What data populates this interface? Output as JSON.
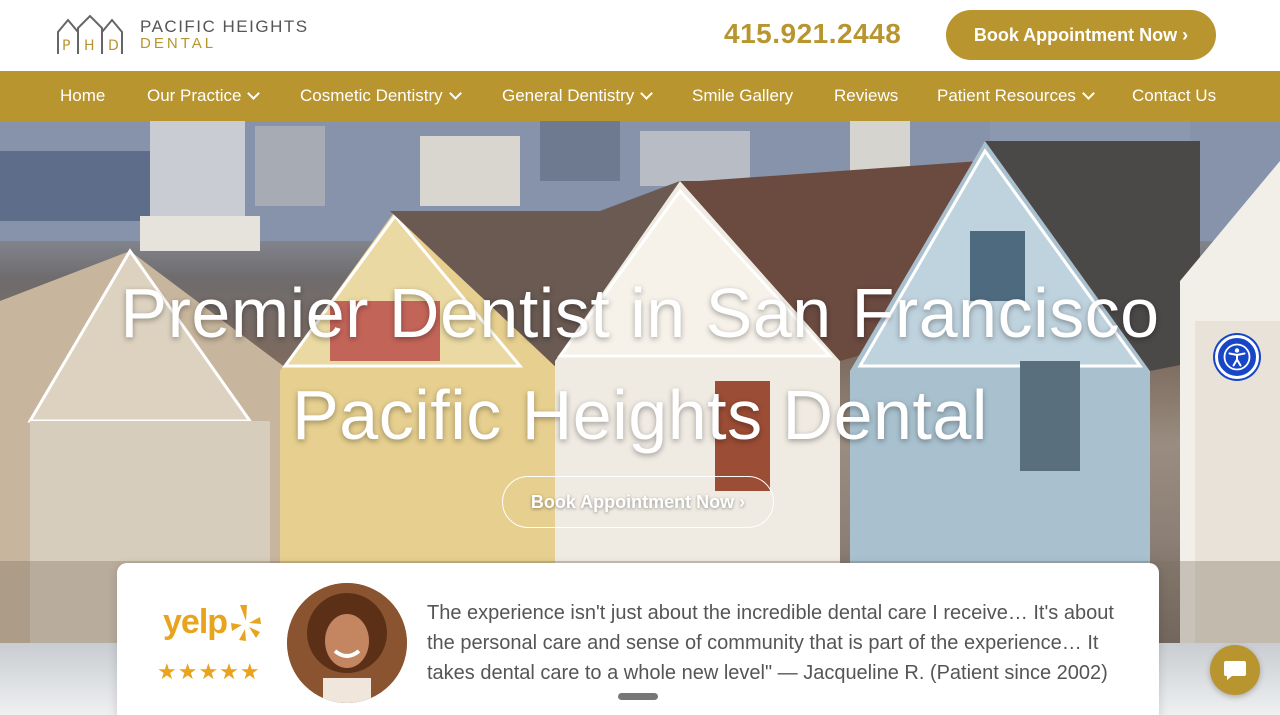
{
  "header": {
    "logo": {
      "line1": "PACIFIC HEIGHTS",
      "line2": "DENTAL",
      "monogram": "PHD"
    },
    "phone": "415.921.2448",
    "book_button": "Book Appointment Now ›"
  },
  "nav": {
    "items": [
      {
        "label": "Home",
        "dropdown": false
      },
      {
        "label": "Our Practice",
        "dropdown": true
      },
      {
        "label": "Cosmetic Dentistry",
        "dropdown": true
      },
      {
        "label": "General Dentistry",
        "dropdown": true
      },
      {
        "label": "Smile Gallery",
        "dropdown": false
      },
      {
        "label": "Reviews",
        "dropdown": false
      },
      {
        "label": "Patient Resources",
        "dropdown": true
      },
      {
        "label": "Contact Us",
        "dropdown": false
      }
    ]
  },
  "hero": {
    "title_line1": "Premier Dentist in San Francisco",
    "title_line2": "Pacific Heights Dental",
    "button": "Book Appointment Now ›"
  },
  "testimonial": {
    "source": "yelp",
    "rating": 5,
    "stars": "★★★★★",
    "quote": "The experience isn't just about the incredible dental care I receive… It's about the personal care and sense of community that is part of the experience… It takes dental care to a whole new level\" — Jacqueline R. (Patient since 2002)"
  },
  "colors": {
    "brand_gold": "#b8952e",
    "accessibility_blue": "#1746c9"
  },
  "icons": [
    "accessibility-icon",
    "chat-icon",
    "chevron-down-icon",
    "yelp-logo"
  ]
}
